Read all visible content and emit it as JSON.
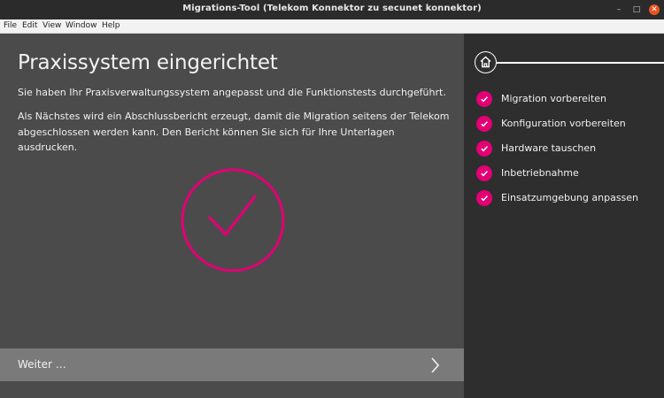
{
  "window": {
    "title": "Migrations-Tool (Telekom Konnektor zu secunet konnektor)",
    "minimize_glyph": "–",
    "maximize_glyph": "□",
    "close_glyph": "✕"
  },
  "menu": {
    "file": "File",
    "edit": "Edit",
    "view": "View",
    "window": "Window",
    "help": "Help"
  },
  "main": {
    "heading": "Praxissystem eingerichtet",
    "paragraph1": "Sie haben Ihr Praxisverwaltungssystem angepasst und die Funktionstests durchgeführt.",
    "paragraph2": "Als Nächstes wird ein Abschlussbericht erzeugt, damit die Migration seitens der Telekom abgeschlossen werden kann. Den Bericht können Sie sich für Ihre Unterlagen ausdrucken.",
    "status_icon": "success-check-icon",
    "next_label": "Weiter …"
  },
  "sidebar": {
    "home_icon": "home-icon",
    "steps": [
      {
        "label": "Migration vorbereiten",
        "state": "done"
      },
      {
        "label": "Konfiguration vorbereiten",
        "state": "done"
      },
      {
        "label": "Hardware tauschen",
        "state": "done"
      },
      {
        "label": "Inbetriebnahme",
        "state": "done"
      },
      {
        "label": "Einsatzumgebung anpassen",
        "state": "done"
      }
    ]
  },
  "colors": {
    "accent": "#e20074",
    "main_bg": "#4b4b4b",
    "sidebar_bg": "#2e2e2e",
    "next_bar_bg": "#7a7a7a"
  }
}
